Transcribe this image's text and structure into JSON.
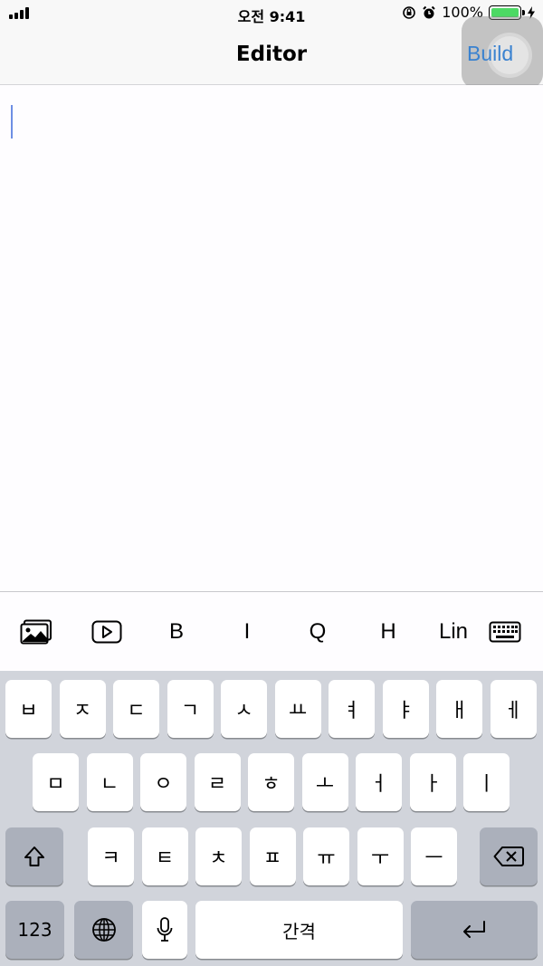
{
  "status": {
    "time": "오전 9:41",
    "battery": "100%"
  },
  "nav": {
    "title": "Editor",
    "build_label": "Build"
  },
  "toolbar": {
    "items": [
      {
        "icon": "image-icon"
      },
      {
        "icon": "video-icon"
      },
      {
        "label": "B"
      },
      {
        "label": "I"
      },
      {
        "label": "Q"
      },
      {
        "label": "H"
      },
      {
        "label": "Lin"
      },
      {
        "icon": "keyboard-icon"
      }
    ]
  },
  "keyboard": {
    "row1": [
      "ㅂ",
      "ㅈ",
      "ㄷ",
      "ㄱ",
      "ㅅ",
      "ㅛ",
      "ㅕ",
      "ㅑ",
      "ㅐ",
      "ㅔ"
    ],
    "row2": [
      "ㅁ",
      "ㄴ",
      "ㅇ",
      "ㄹ",
      "ㅎ",
      "ㅗ",
      "ㅓ",
      "ㅏ",
      "ㅣ"
    ],
    "row3": [
      "ㅋ",
      "ㅌ",
      "ㅊ",
      "ㅍ",
      "ㅠ",
      "ㅜ",
      "ㅡ"
    ],
    "numbers_label": "123",
    "space_label": "간격",
    "icons": {
      "shift": "shift-icon",
      "delete": "delete-icon",
      "globe": "globe-icon",
      "mic": "mic-icon",
      "return": "return-icon"
    }
  },
  "colors": {
    "accent": "#3a82d0",
    "caret": "#6e8fe4",
    "battery": "#4cd964",
    "keyboard_bg": "#d1d4db",
    "key_dark": "#abb0bb"
  }
}
